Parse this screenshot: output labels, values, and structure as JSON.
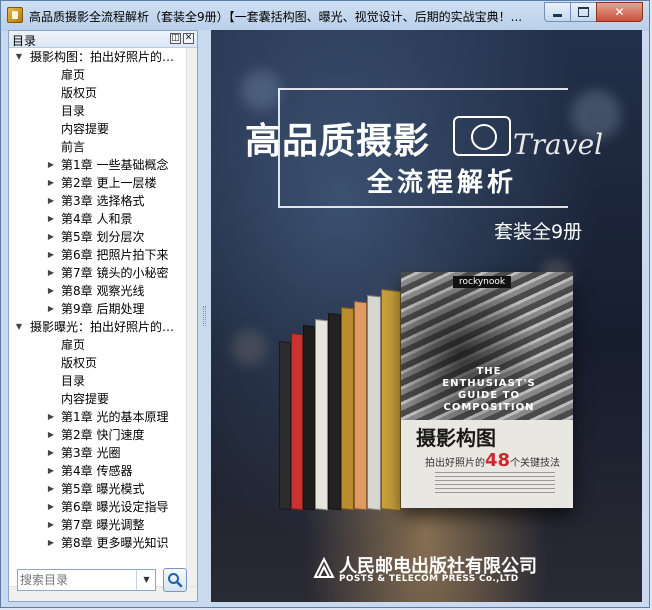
{
  "window": {
    "title": "高品质摄影全流程解析（套装全9册）【一套囊括构图、曝光、视觉设计、后期的实战宝典！...",
    "controls": {
      "close": "✕"
    }
  },
  "sidebar": {
    "title": "目录",
    "float_button": "◫",
    "close_button": "✕",
    "tree": [
      {
        "label": "摄影构图：拍出好照片的…",
        "level": 0,
        "expanded": true
      },
      {
        "label": "扉页",
        "level": 1
      },
      {
        "label": "版权页",
        "level": 1
      },
      {
        "label": "目录",
        "level": 1
      },
      {
        "label": "内容提要",
        "level": 1
      },
      {
        "label": "前言",
        "level": 1
      },
      {
        "label": "第1章  一些基础概念",
        "level": 1,
        "collapsed": true
      },
      {
        "label": "第2章  更上一层楼",
        "level": 1,
        "collapsed": true
      },
      {
        "label": "第3章  选择格式",
        "level": 1,
        "collapsed": true
      },
      {
        "label": "第4章  人和景",
        "level": 1,
        "collapsed": true
      },
      {
        "label": "第5章  划分层次",
        "level": 1,
        "collapsed": true
      },
      {
        "label": "第6章  把照片拍下来",
        "level": 1,
        "collapsed": true
      },
      {
        "label": "第7章  镜头的小秘密",
        "level": 1,
        "collapsed": true
      },
      {
        "label": "第8章  观察光线",
        "level": 1,
        "collapsed": true
      },
      {
        "label": "第9章  后期处理",
        "level": 1,
        "collapsed": true
      },
      {
        "label": "摄影曝光：拍出好照片的…",
        "level": 0,
        "expanded": true
      },
      {
        "label": "扉页",
        "level": 1
      },
      {
        "label": "版权页",
        "level": 1
      },
      {
        "label": "目录",
        "level": 1
      },
      {
        "label": "内容提要",
        "level": 1
      },
      {
        "label": "第1章  光的基本原理",
        "level": 1,
        "collapsed": true
      },
      {
        "label": "第2章  快门速度",
        "level": 1,
        "collapsed": true
      },
      {
        "label": "第3章  光圈",
        "level": 1,
        "collapsed": true
      },
      {
        "label": "第4章  传感器",
        "level": 1,
        "collapsed": true
      },
      {
        "label": "第5章  曝光模式",
        "level": 1,
        "collapsed": true
      },
      {
        "label": "第6章  曝光设定指导",
        "level": 1,
        "collapsed": true
      },
      {
        "label": "第7章  曝光调整",
        "level": 1,
        "collapsed": true
      },
      {
        "label": "第8章  更多曝光知识",
        "level": 1,
        "collapsed": true
      }
    ],
    "search": {
      "placeholder": "搜索目录"
    }
  },
  "cover": {
    "title": "高品质摄影",
    "subtitle": "全流程解析",
    "script": "Travel",
    "set_label": "套装全9册",
    "front_book": {
      "imprint": "rockynook",
      "en_title": "THE ENTHUSIAST'S GUIDE TO COMPOSITION",
      "cn_title": "摄影构图",
      "tagline_pre": "拍出好照片的",
      "tagline_num": "48",
      "tagline_post": "个关键技法"
    },
    "publisher_cn": "人民邮电出版社有限公司",
    "publisher_en": "POSTS & TELECOM PRESS Co.,LTD"
  }
}
